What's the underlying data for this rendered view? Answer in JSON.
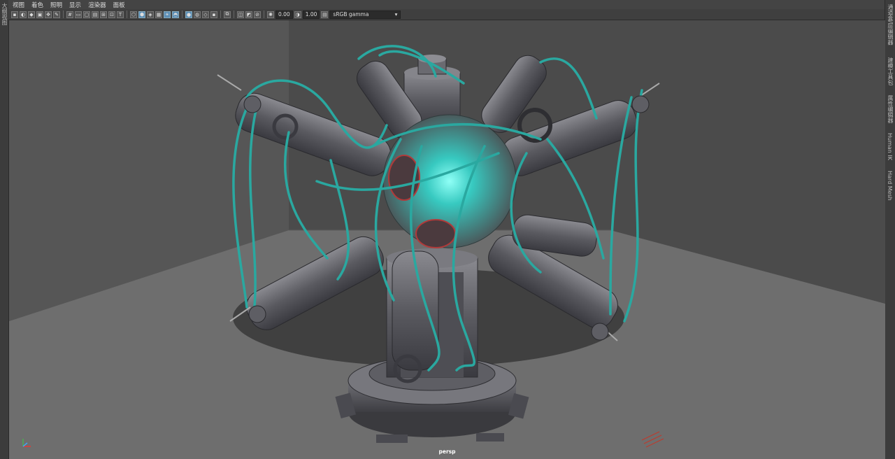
{
  "left_panel": {
    "tab": "大纲视图"
  },
  "menu": [
    "视图",
    "着色",
    "照明",
    "显示",
    "渲染器",
    "面板"
  ],
  "toolbar": {
    "exposure_value": "0.00",
    "gamma_value": "1.00",
    "color_space": "sRGB gamma"
  },
  "right_panel": {
    "tabs": [
      "通道盒/层编辑器",
      "建模工具包",
      "属性编辑器",
      "Human IK",
      "Hard Mesh"
    ]
  },
  "viewport": {
    "camera_label": "persp"
  },
  "colors": {
    "cable": "#2aa8a0",
    "glow": "#3fe0d8",
    "metal": "#6c6c72",
    "floor": "#6e6e6e",
    "wall_back": "#4a4a4a"
  }
}
